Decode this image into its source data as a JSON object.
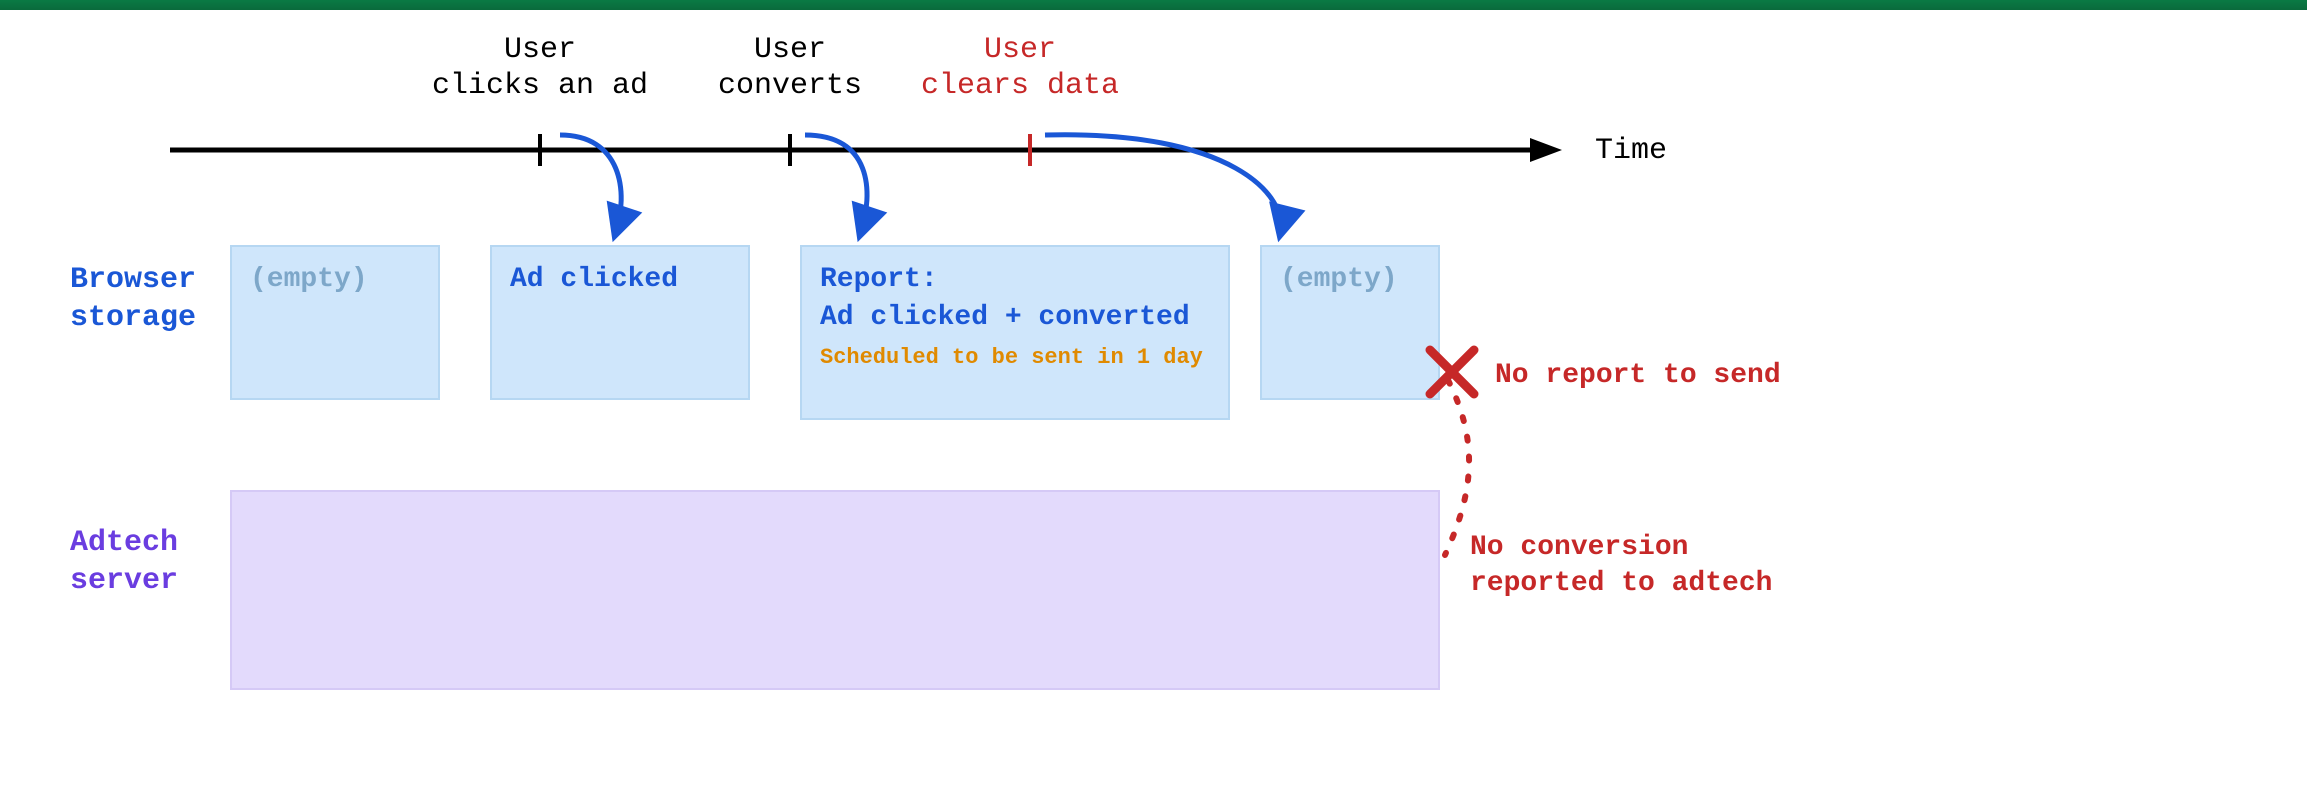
{
  "timeline": {
    "axis_label": "Time",
    "events": [
      {
        "id": "clicks",
        "label": "User\nclicks an ad",
        "color": "black"
      },
      {
        "id": "converts",
        "label": "User\nconverts",
        "color": "black"
      },
      {
        "id": "clears",
        "label": "User\nclears data",
        "color": "red"
      }
    ]
  },
  "lanes": {
    "browser_storage": {
      "label": "Browser\nstorage",
      "boxes": [
        {
          "id": "empty1",
          "text": "(empty)",
          "style": "faded"
        },
        {
          "id": "clicked",
          "text": "Ad clicked",
          "style": "blue"
        },
        {
          "id": "report",
          "text": "Report:\nAd clicked + converted",
          "style": "blue",
          "subtext": "Scheduled to be sent in 1 day"
        },
        {
          "id": "empty2",
          "text": "(empty)",
          "style": "faded"
        }
      ]
    },
    "adtech_server": {
      "label": "Adtech\nserver"
    }
  },
  "errors": {
    "no_report": "No report to send",
    "no_conversion": "No conversion\nreported to adtech"
  },
  "colors": {
    "blue": "#1a57d6",
    "red": "#c62828",
    "orange": "#e08a00",
    "storage_bg": "#cfe6fb",
    "server_bg": "#e3dafc"
  }
}
